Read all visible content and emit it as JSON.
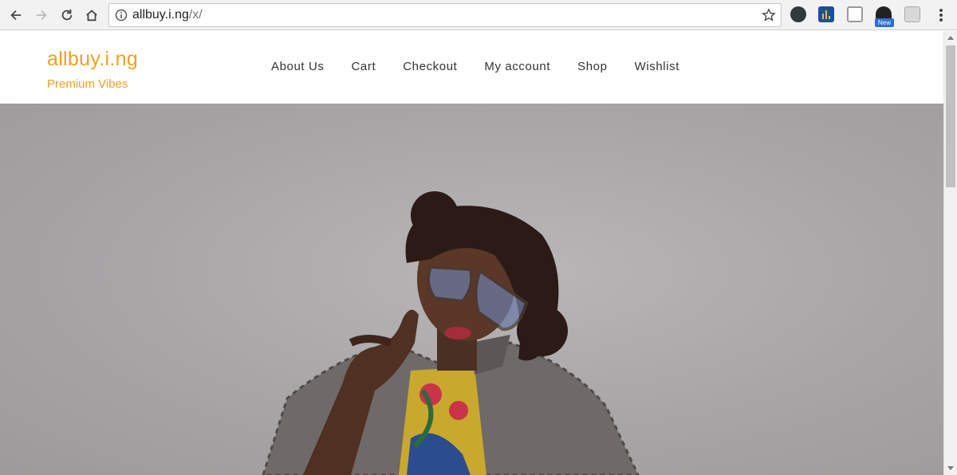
{
  "browser": {
    "url_host": "allbuy.i.ng",
    "url_path": "/x/",
    "extension_badge": "New"
  },
  "site": {
    "brand": "allbuy.i.ng",
    "tagline": "Premium Vibes",
    "nav": [
      "About Us",
      "Cart",
      "Checkout",
      "My account",
      "Shop",
      "Wishlist"
    ]
  },
  "colors": {
    "brand": "#f0a020",
    "nav_text": "#333333"
  }
}
